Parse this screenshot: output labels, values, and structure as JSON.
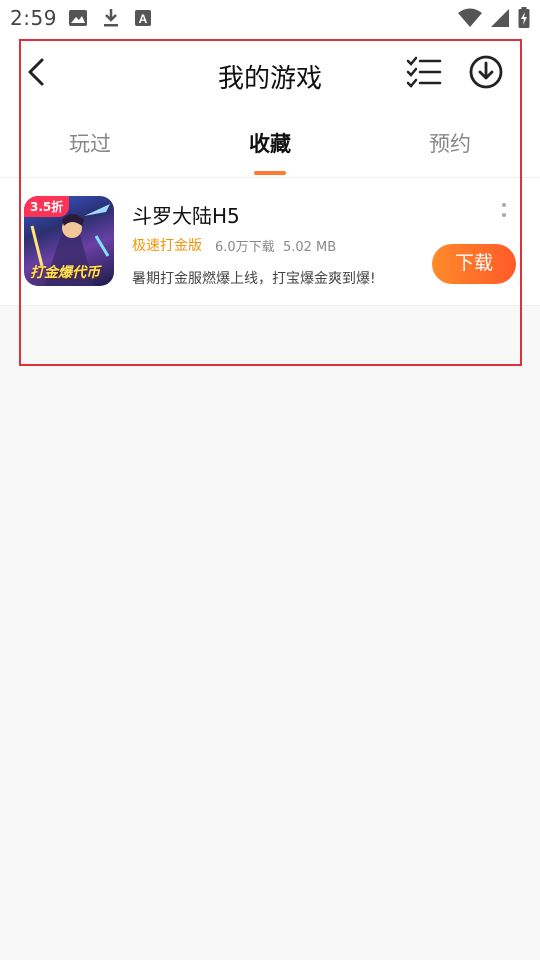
{
  "status_bar": {
    "time": "2:59",
    "left_icons": [
      "image-icon",
      "download-icon",
      "font-icon"
    ],
    "right_icons": [
      "wifi-icon",
      "signal-icon",
      "battery-icon"
    ]
  },
  "header": {
    "title": "我的游戏",
    "back_icon": "back-arrow-icon",
    "manage_icon": "checklist-icon",
    "download_manager_icon": "download-circle-icon"
  },
  "tabs": [
    {
      "label": "玩过",
      "active": false
    },
    {
      "label": "收藏",
      "active": true
    },
    {
      "label": "预约",
      "active": false
    }
  ],
  "games": [
    {
      "name": "斗罗大陆H5",
      "badge": "3.5折",
      "icon_caption": "打金爆代币",
      "tag": "极速打金版",
      "downloads": "6.0万下载",
      "size": "5.02 MB",
      "description": "暑期打金服燃爆上线，打宝爆金爽到爆!",
      "action_label": "下载"
    }
  ],
  "colors": {
    "accent": "#ff7a2e",
    "tag": "#f2960f",
    "highlight": "#e0303a"
  }
}
